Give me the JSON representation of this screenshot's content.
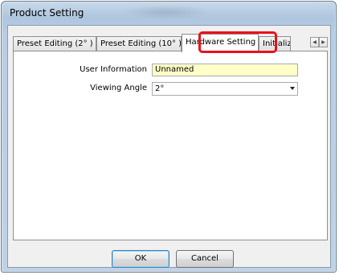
{
  "window": {
    "title": "Product Setting"
  },
  "tabs": [
    {
      "label": "Preset Editing (2° )",
      "active": false
    },
    {
      "label": "Preset Editing (10° )",
      "active": false
    },
    {
      "label": "Hardware Setting",
      "active": true
    },
    {
      "label": "Initialize",
      "active": false
    }
  ],
  "tab_scroll": {
    "left": "◀",
    "right": "▶"
  },
  "form": {
    "user_information": {
      "label": "User Information",
      "value": "Unnamed"
    },
    "viewing_angle": {
      "label": "Viewing Angle",
      "value": "2°"
    }
  },
  "buttons": {
    "ok": "OK",
    "cancel": "Cancel"
  },
  "colors": {
    "highlight": "#e8121a",
    "input_background": "#ffffc8"
  }
}
